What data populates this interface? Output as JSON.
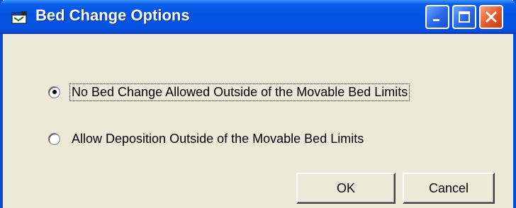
{
  "window": {
    "title": "Bed Change Options",
    "controls": [
      "minimize-icon",
      "maximize-icon",
      "close-icon"
    ],
    "accent_color": "#0454e3",
    "close_color": "#e2572a"
  },
  "options": [
    {
      "label": "No Bed Change Allowed Outside of the Movable Bed Limits",
      "selected": true,
      "focused": true
    },
    {
      "label": "Allow Deposition Outside of the Movable Bed Limits",
      "selected": false,
      "focused": false
    }
  ],
  "buttons": {
    "ok_label": "OK",
    "cancel_label": "Cancel"
  }
}
